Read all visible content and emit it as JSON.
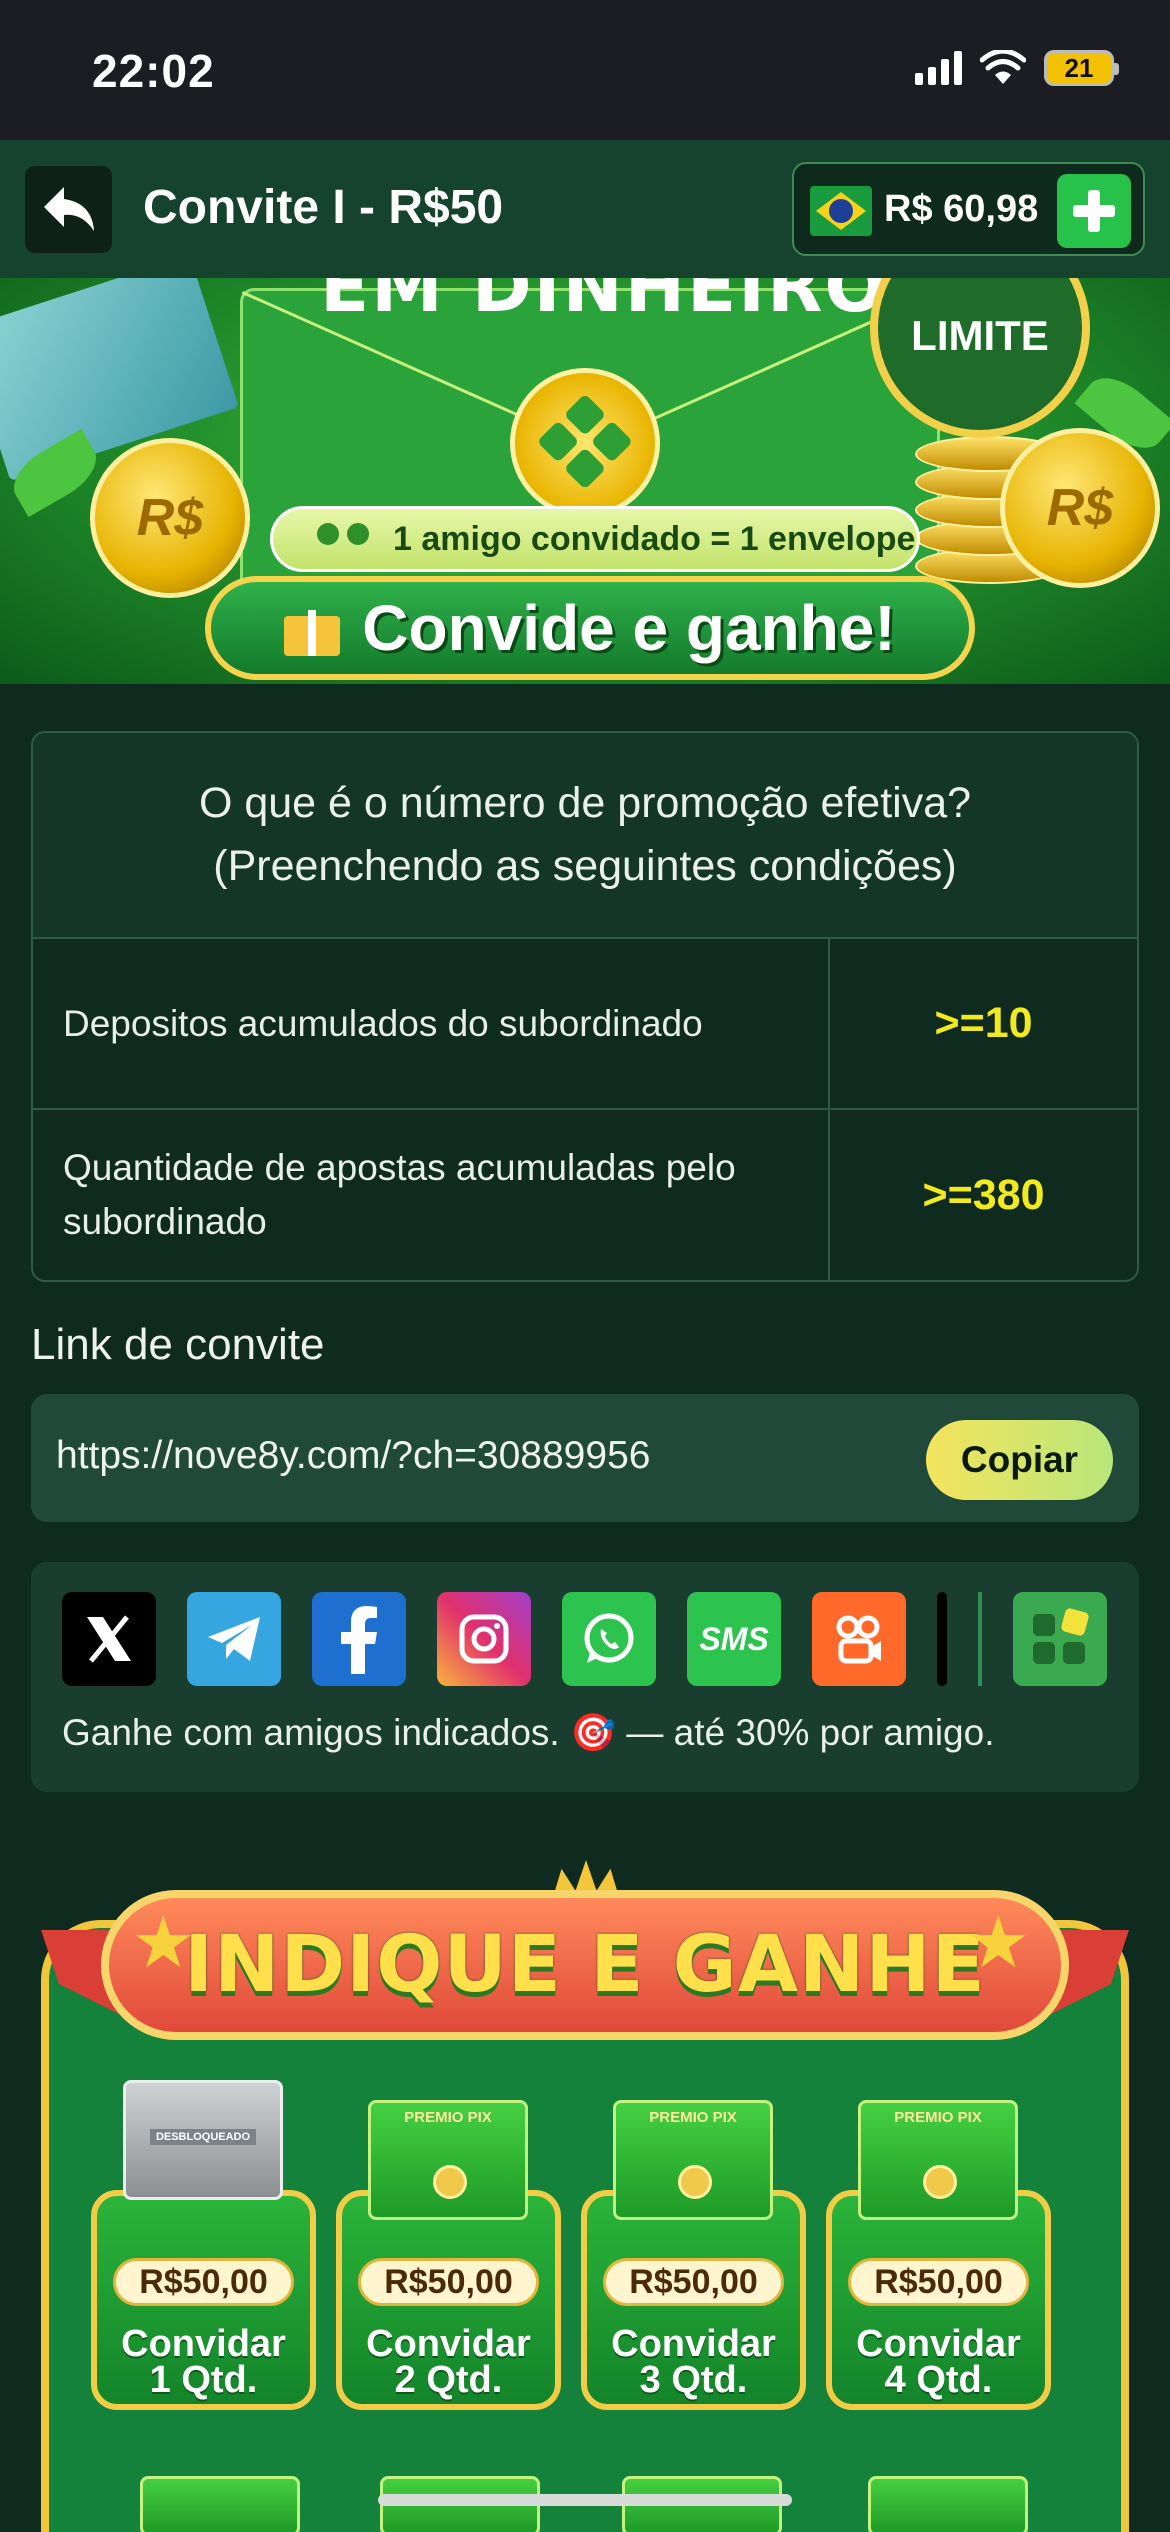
{
  "status_bar": {
    "time": "22:02",
    "battery": "21"
  },
  "header": {
    "title": "Convite I - R$50",
    "balance": "R$ 60,98"
  },
  "banner": {
    "top_text": "EM DINHEIRO",
    "badge_text": "LIMITE",
    "friend_line": "1 amigo convidado = 1 envelope",
    "invite_line": "Convide e ganhe!",
    "coin_symbol": "R$"
  },
  "conditions": {
    "heading_line1": "O que é o número de promoção efetiva?",
    "heading_line2": "(Preenchendo as seguintes condições)",
    "rows": [
      {
        "label": "Depositos acumulados do subordinado",
        "value": ">=10"
      },
      {
        "label": "Quantidade de apostas acumuladas pelo subordinado",
        "value": ">=380"
      }
    ]
  },
  "invite_link": {
    "title": "Link de convite",
    "url": "https://nove8y.com/?ch=30889956",
    "copy_label": "Copiar"
  },
  "share": {
    "icons": [
      "x-icon",
      "telegram-icon",
      "facebook-icon",
      "instagram-icon",
      "whatsapp-icon",
      "sms-icon",
      "kwai-icon",
      "more-apps-icon"
    ],
    "sms_text": "SMS",
    "caption": "Ganhe com amigos indicados. 🎯 — até 30% por amigo."
  },
  "indique": {
    "title": "INDIQUE E GANHE",
    "rewards": [
      {
        "amount": "R$50,00",
        "line1": "Convidar",
        "line2": "1 Qtd.",
        "envelope": "DESBLOQUEADO",
        "locked": true
      },
      {
        "amount": "R$50,00",
        "line1": "Convidar",
        "line2": "2 Qtd.",
        "envelope": "PREMIO PIX",
        "locked": false
      },
      {
        "amount": "R$50,00",
        "line1": "Convidar",
        "line2": "3 Qtd.",
        "envelope": "PREMIO PIX",
        "locked": false
      },
      {
        "amount": "R$50,00",
        "line1": "Convidar",
        "line2": "4 Qtd.",
        "envelope": "PREMIO PIX",
        "locked": false
      }
    ]
  },
  "colors": {
    "accent": "#26c24a",
    "highlight": "#f2ea1c",
    "background": "#0f2b1f"
  }
}
